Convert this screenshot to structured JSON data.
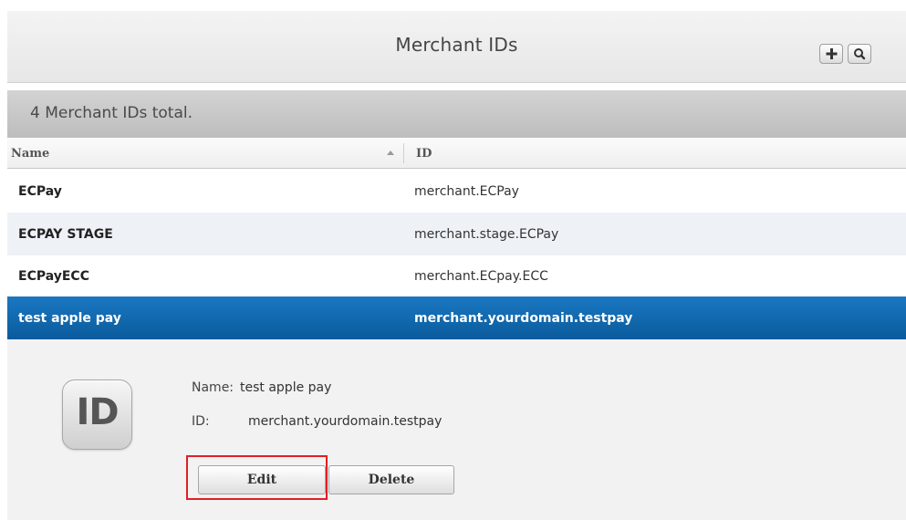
{
  "header": {
    "title": "Merchant IDs",
    "add_icon": "plus-icon",
    "search_icon": "search-icon"
  },
  "summary": {
    "text": "4  Merchant IDs total."
  },
  "table": {
    "columns": [
      "Name",
      "ID"
    ],
    "rows": [
      {
        "name": "ECPay",
        "id": "merchant.ECPay"
      },
      {
        "name": "ECPAY STAGE",
        "id": "merchant.stage.ECPay"
      },
      {
        "name": "ECPayECC",
        "id": "merchant.ECpay.ECC"
      },
      {
        "name": "test apple pay",
        "id": "merchant.yourdomain.testpay"
      }
    ]
  },
  "detail": {
    "icon_text": "ID",
    "name_label": "Name:",
    "name_value": "test apple pay",
    "id_label": "ID:",
    "id_value": "merchant.yourdomain.testpay",
    "edit_label": "Edit",
    "delete_label": "Delete"
  },
  "colors": {
    "selected_row": "#1a78c2",
    "highlight_border": "#e31e24"
  }
}
